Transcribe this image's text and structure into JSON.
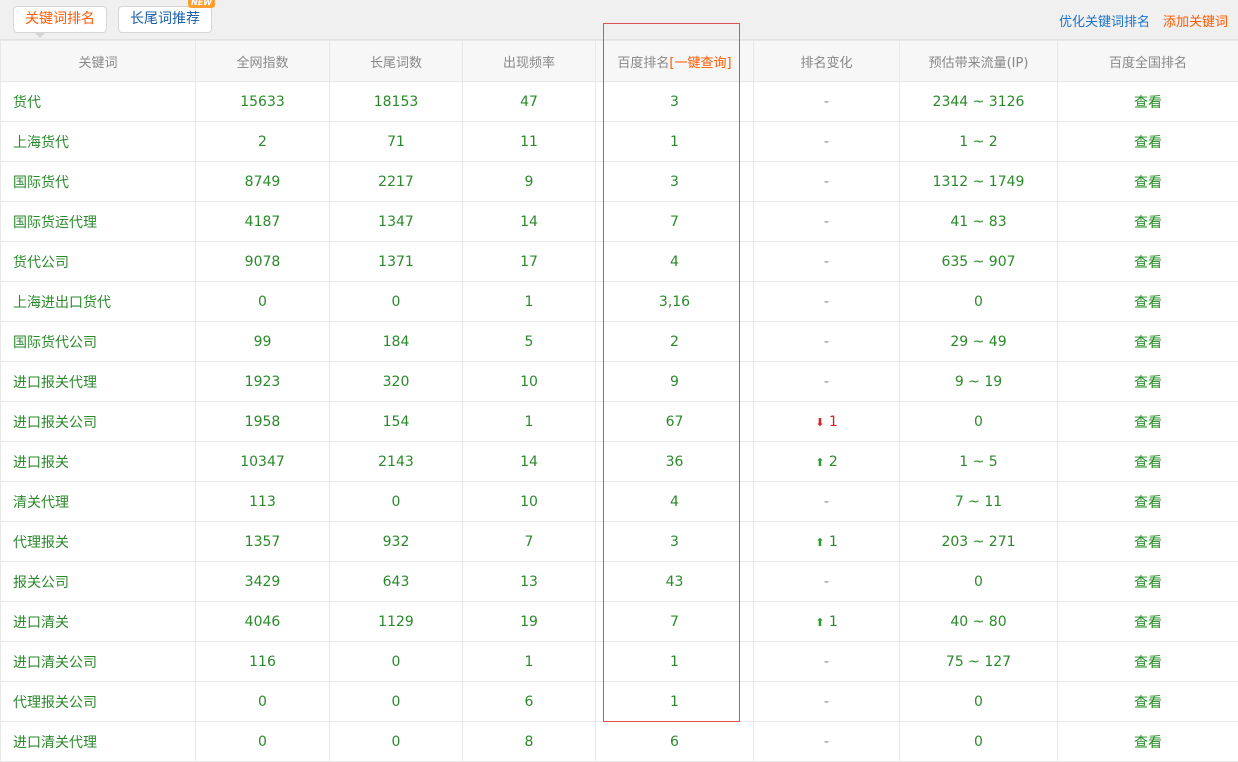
{
  "tabs": {
    "keyword_rank": "关键词排名",
    "longtail": "长尾词推荐",
    "new_badge": "NEW"
  },
  "links": {
    "optimize": "优化关键词排名",
    "add": "添加关键词"
  },
  "headers": {
    "keyword": "关键词",
    "index": "全网指数",
    "longtail": "长尾词数",
    "freq": "出现频率",
    "baidu_rank": "百度排名",
    "baidu_rank_link": "[一键查询]",
    "change": "排名变化",
    "traffic": "预估带来流量(IP)",
    "national": "百度全国排名"
  },
  "view_label": "查看",
  "colors": {
    "accent": "#ff5a00",
    "green": "#2a8a2a",
    "red": "#dd2222",
    "blue": "#1a73c8"
  },
  "rows": [
    {
      "keyword": "货代",
      "index": "15633",
      "longtail": "18153",
      "freq": "47",
      "rank": "3",
      "change": "-",
      "traffic": "2344 ~ 3126"
    },
    {
      "keyword": "上海货代",
      "index": "2",
      "longtail": "71",
      "freq": "11",
      "rank": "1",
      "change": "-",
      "traffic": "1 ~ 2"
    },
    {
      "keyword": "国际货代",
      "index": "8749",
      "longtail": "2217",
      "freq": "9",
      "rank": "3",
      "change": "-",
      "traffic": "1312 ~ 1749"
    },
    {
      "keyword": "国际货运代理",
      "index": "4187",
      "longtail": "1347",
      "freq": "14",
      "rank": "7",
      "change": "-",
      "traffic": "41 ~ 83"
    },
    {
      "keyword": "货代公司",
      "index": "9078",
      "longtail": "1371",
      "freq": "17",
      "rank": "4",
      "change": "-",
      "traffic": "635 ~ 907"
    },
    {
      "keyword": "上海进出口货代",
      "index": "0",
      "longtail": "0",
      "freq": "1",
      "rank": "3,16",
      "change": "-",
      "traffic": "0"
    },
    {
      "keyword": "国际货代公司",
      "index": "99",
      "longtail": "184",
      "freq": "5",
      "rank": "2",
      "change": "-",
      "traffic": "29 ~ 49"
    },
    {
      "keyword": "进口报关代理",
      "index": "1923",
      "longtail": "320",
      "freq": "10",
      "rank": "9",
      "change": "-",
      "traffic": "9 ~ 19"
    },
    {
      "keyword": "进口报关公司",
      "index": "1958",
      "longtail": "154",
      "freq": "1",
      "rank": "67",
      "change": "1",
      "change_dir": "down",
      "traffic": "0"
    },
    {
      "keyword": "进口报关",
      "index": "10347",
      "longtail": "2143",
      "freq": "14",
      "rank": "36",
      "change": "2",
      "change_dir": "up",
      "traffic": "1 ~ 5"
    },
    {
      "keyword": "清关代理",
      "index": "113",
      "longtail": "0",
      "freq": "10",
      "rank": "4",
      "change": "-",
      "traffic": "7 ~ 11"
    },
    {
      "keyword": "代理报关",
      "index": "1357",
      "longtail": "932",
      "freq": "7",
      "rank": "3",
      "change": "1",
      "change_dir": "up",
      "traffic": "203 ~ 271"
    },
    {
      "keyword": "报关公司",
      "index": "3429",
      "longtail": "643",
      "freq": "13",
      "rank": "43",
      "change": "-",
      "traffic": "0"
    },
    {
      "keyword": "进口清关",
      "index": "4046",
      "longtail": "1129",
      "freq": "19",
      "rank": "7",
      "change": "1",
      "change_dir": "up",
      "traffic": "40 ~ 80"
    },
    {
      "keyword": "进口清关公司",
      "index": "116",
      "longtail": "0",
      "freq": "1",
      "rank": "1",
      "change": "-",
      "traffic": "75 ~ 127"
    },
    {
      "keyword": "代理报关公司",
      "index": "0",
      "longtail": "0",
      "freq": "6",
      "rank": "1",
      "change": "-",
      "traffic": "0"
    },
    {
      "keyword": "进口清关代理",
      "index": "0",
      "longtail": "0",
      "freq": "8",
      "rank": "6",
      "change": "-",
      "traffic": "0"
    }
  ]
}
